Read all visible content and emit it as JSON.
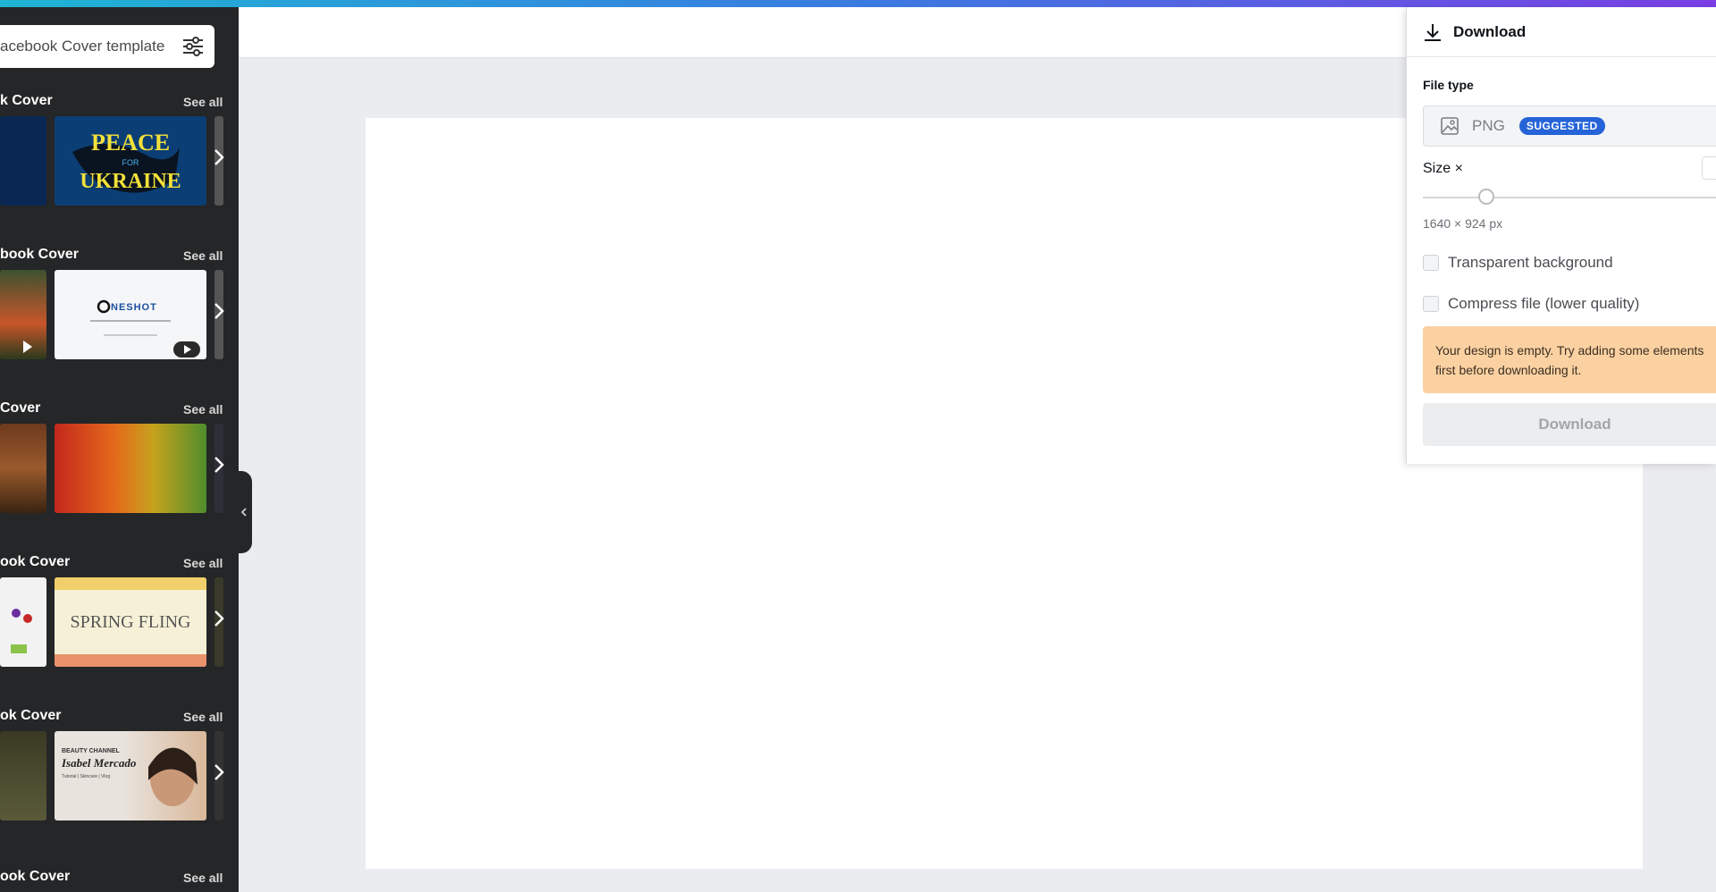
{
  "search": {
    "value": "acebook Cover template"
  },
  "sections": [
    {
      "title": "k Cover",
      "see_all": "See all",
      "thumb_text": [
        "PEACE",
        "FOR",
        "UKRAINE"
      ]
    },
    {
      "title": "book Cover",
      "see_all": "See all",
      "thumb_text": [
        "NESHOT"
      ]
    },
    {
      "title": "Cover",
      "see_all": "See all"
    },
    {
      "title": "ook Cover",
      "see_all": "See all",
      "thumb_text": [
        "SPRING FLING"
      ]
    },
    {
      "title": "ok Cover",
      "see_all": "See all",
      "thumb_text": [
        "BEAUTY CHANNEL",
        "Isabel Mercado",
        "Tutorial | Skincare | Vlog"
      ]
    },
    {
      "title": "ook Cover",
      "see_all": "See all"
    }
  ],
  "panel": {
    "title": "Download",
    "file_type_label": "File type",
    "file_type_value": "PNG",
    "suggested_badge": "SUGGESTED",
    "size_label": "Size ×",
    "dimensions": "1640 × 924 px",
    "transparent_bg": "Transparent background",
    "compress": "Compress file (lower quality)",
    "warning": "Your design is empty. Try adding some elements first before downloading it.",
    "download_button": "Download"
  },
  "colors": {
    "accent": "#2564d8",
    "sidebar": "#252627",
    "warning_bg": "#fbd1a2"
  }
}
